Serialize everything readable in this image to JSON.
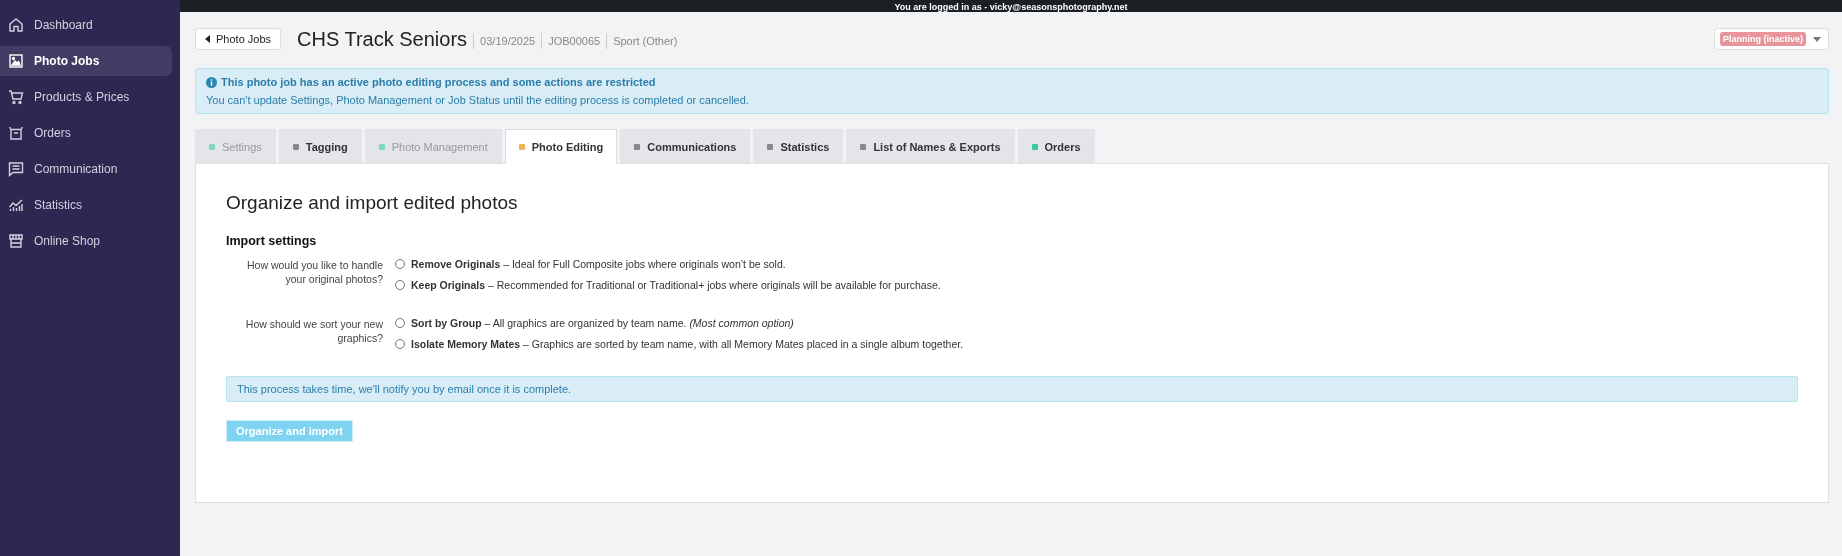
{
  "top_bar": {
    "text": "You are logged in as - vicky@seasonsphotography.net"
  },
  "sidebar": {
    "items": [
      {
        "label": "Dashboard",
        "kind": "home",
        "selected": false
      },
      {
        "label": "Photo Jobs",
        "kind": "image",
        "selected": true
      },
      {
        "label": "Products & Prices",
        "kind": "cart",
        "selected": false
      },
      {
        "label": "Orders",
        "kind": "box",
        "selected": false
      },
      {
        "label": "Communication",
        "kind": "message",
        "selected": false
      },
      {
        "label": "Statistics",
        "kind": "chart",
        "selected": false
      },
      {
        "label": "Online Shop",
        "kind": "store",
        "selected": false
      }
    ]
  },
  "header": {
    "back_button": "Photo Jobs",
    "title": "CHS Track Seniors",
    "meta": [
      "03/19/2025",
      "JOB00065",
      "Sport (Other)"
    ],
    "status": {
      "label": "Planning (inactive)",
      "color": "#e8949b"
    }
  },
  "alert": {
    "title": "This photo job has an active photo editing process and some actions are restricted",
    "text": "You can't update Settings, Photo Management or Job Status until the editing process is completed or cancelled."
  },
  "tabs": [
    {
      "label": "Settings",
      "selected": false,
      "disabled": true,
      "color": "#7fd8c0"
    },
    {
      "label": "Tagging",
      "selected": false,
      "disabled": false,
      "color": "#888888"
    },
    {
      "label": "Photo Management",
      "selected": false,
      "disabled": true,
      "color": "#7fd8c0"
    },
    {
      "label": "Photo Editing",
      "selected": true,
      "disabled": false,
      "color": "#f3b253"
    },
    {
      "label": "Communications",
      "selected": false,
      "disabled": false,
      "color": "#888888"
    },
    {
      "label": "Statistics",
      "selected": false,
      "disabled": false,
      "color": "#888888"
    },
    {
      "label": "List of Names & Exports",
      "selected": false,
      "disabled": false,
      "color": "#888888"
    },
    {
      "label": "Orders",
      "selected": false,
      "disabled": false,
      "color": "#3cc99a"
    }
  ],
  "panel": {
    "heading": "Organize and import edited photos",
    "subheading": "Import settings",
    "questions": [
      {
        "label": "How would you like to handle your original photos?",
        "options": [
          {
            "text": "**Remove Originals** – Ideal for Full Composite jobs where originals won’t be sold.",
            "checked": false
          },
          {
            "text": "**Keep Originals** – Recommended for Traditional or Traditional+ jobs where originals will be available for purchase.",
            "checked": false
          }
        ]
      },
      {
        "label": "How should we sort your new graphics?",
        "options": [
          {
            "text": "**Sort by Group** – All graphics are organized by team name.  *(Most common option)*",
            "checked": false
          },
          {
            "text": "**Isolate Memory Mates** – Graphics are sorted by team name, with all Memory Mates placed in a single album together.",
            "checked": false
          }
        ]
      }
    ],
    "notice": "This process takes time, we'll notify you by email once it is complete.",
    "submit": {
      "label": "Organize and import",
      "disabled": true
    }
  }
}
